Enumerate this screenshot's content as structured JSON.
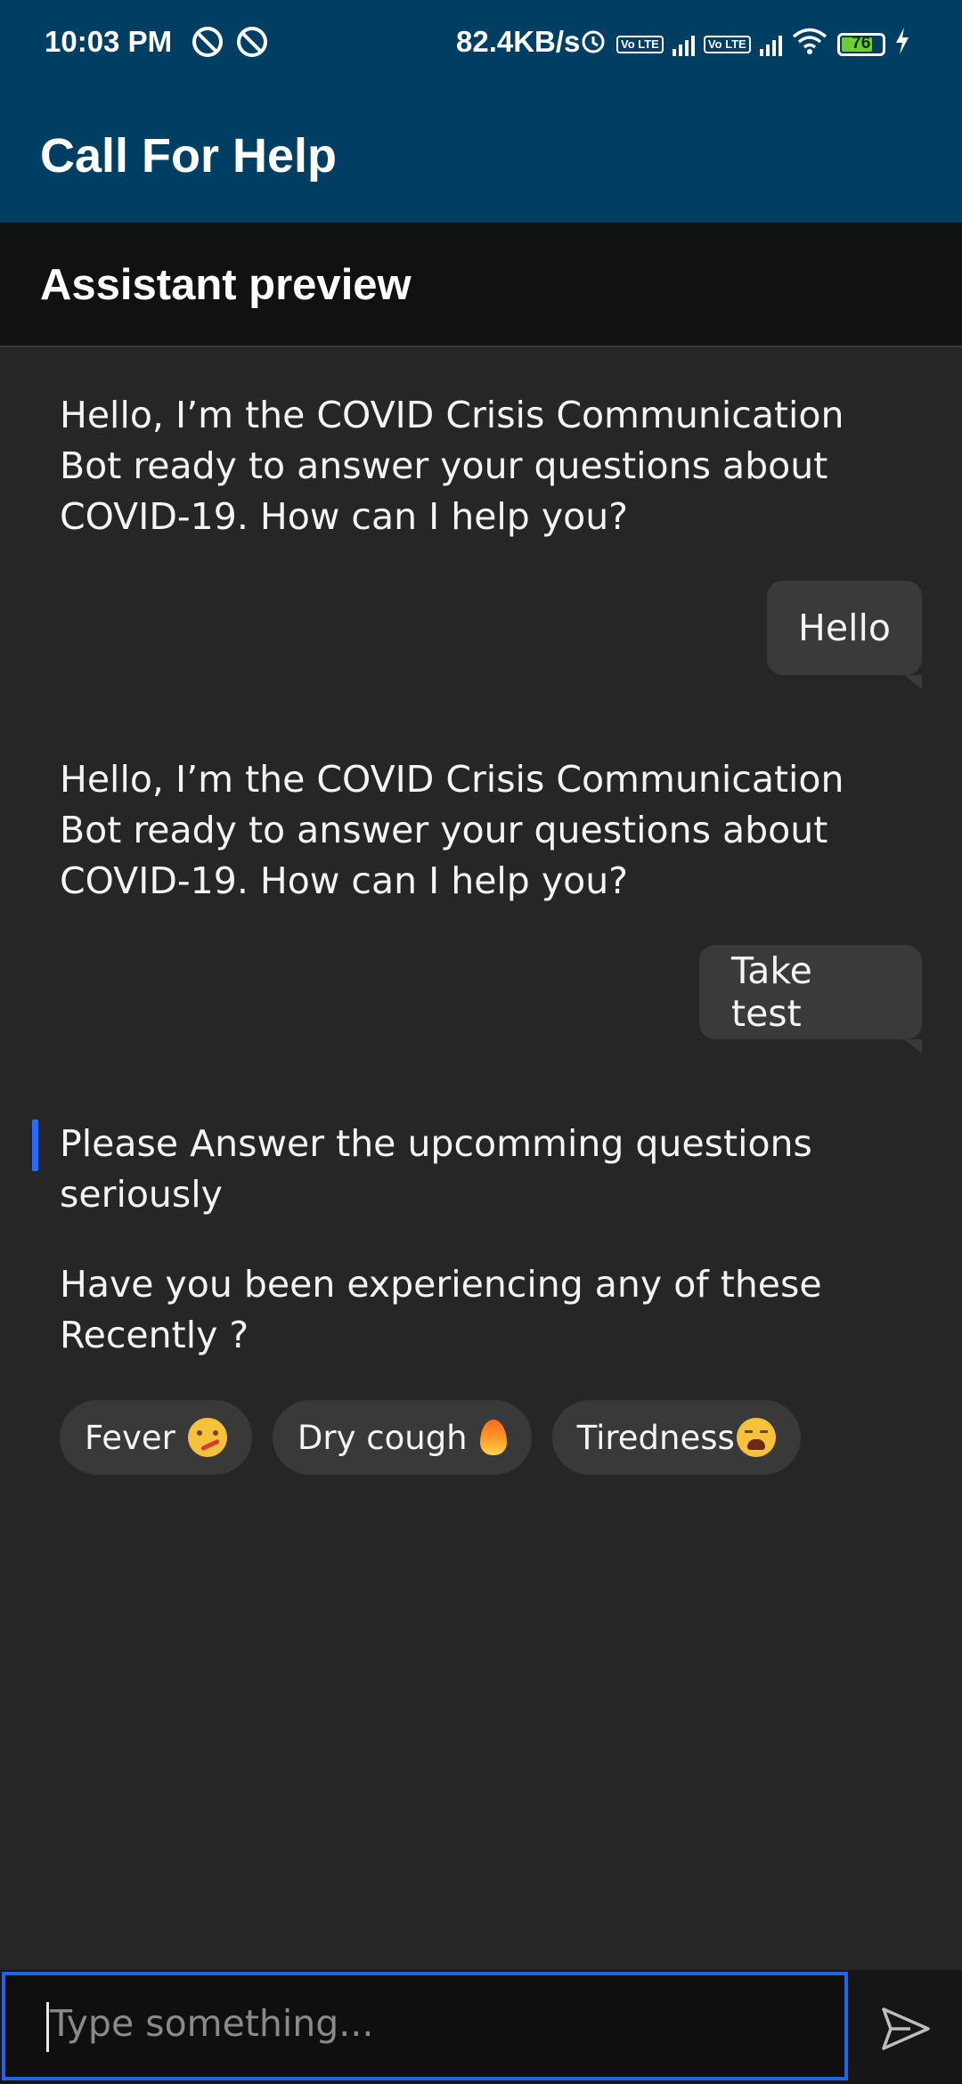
{
  "status_bar": {
    "time": "10:03 PM",
    "net_speed": "82.4KB/s",
    "lte_label": "Vo LTE",
    "battery_percent": "76",
    "icons": [
      "sync-icon",
      "sync-icon",
      "alarm-icon",
      "volte-icon",
      "signal-icon",
      "volte-icon",
      "signal-icon",
      "wifi-icon",
      "battery-icon",
      "charging-icon"
    ]
  },
  "app_bar": {
    "title": "Call For Help"
  },
  "sub_header": {
    "title": "Assistant preview"
  },
  "conversation": [
    {
      "from": "bot",
      "text": "Hello, I’m the COVID Crisis Communication Bot ready to answer your questions about COVID-19. How can I help you?"
    },
    {
      "from": "user",
      "text": "Hello"
    },
    {
      "from": "bot",
      "text": "Hello, I’m the COVID Crisis Communication Bot ready to answer your questions about COVID-19. How can I help you?"
    },
    {
      "from": "user",
      "text": "Take test"
    },
    {
      "from": "bot",
      "text": "Please Answer the upcomming questions seriously"
    },
    {
      "from": "bot",
      "text": "Have you been experiencing any of these Recently ?"
    }
  ],
  "quick_replies": [
    {
      "label": "Fever",
      "icon": "thermometer-face-emoji"
    },
    {
      "label": "Dry cough",
      "icon": "fire-emoji"
    },
    {
      "label": "Tiredness",
      "icon": "weary-face-emoji"
    }
  ],
  "composer": {
    "placeholder": "Type something...",
    "send_icon": "send-icon"
  },
  "colors": {
    "header": "#003f63",
    "background": "#262626",
    "accent": "#1f66e6"
  }
}
